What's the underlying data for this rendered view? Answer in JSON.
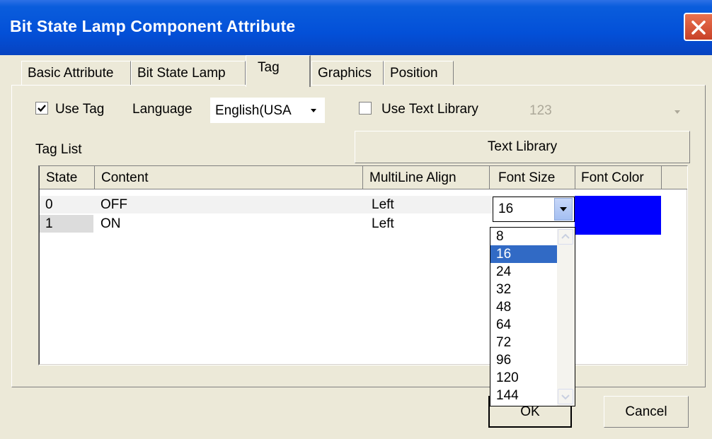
{
  "window": {
    "title": "Bit State Lamp Component Attribute",
    "close_icon": "close-icon"
  },
  "tabs": [
    {
      "label": "Basic Attribute",
      "active": false
    },
    {
      "label": "Bit State Lamp",
      "active": false
    },
    {
      "label": "Tag",
      "active": true
    },
    {
      "label": "Graphics",
      "active": false
    },
    {
      "label": "Position",
      "active": false
    }
  ],
  "tag_options": {
    "use_tag_label": "Use Tag",
    "use_tag_checked": true,
    "language_label": "Language",
    "language_value": "English(USA",
    "use_text_library_label": "Use Text Library",
    "use_text_library_checked": false,
    "text_library_select_value": "123",
    "text_library_button": "Text Library",
    "tag_list_label": "Tag List"
  },
  "table": {
    "columns": [
      "State",
      "Content",
      "MultiLine Align",
      "Font Size",
      "Font Color"
    ],
    "rows": [
      {
        "state": "0",
        "content": "OFF",
        "align": "Left",
        "font_size": "16",
        "font_color": "#0000ff"
      },
      {
        "state": "1",
        "content": "ON",
        "align": "Left",
        "font_size": "",
        "font_color": "#0000ff"
      }
    ]
  },
  "font_size_dropdown": {
    "value": "16",
    "options": [
      "8",
      "16",
      "24",
      "32",
      "48",
      "64",
      "72",
      "96",
      "120",
      "144"
    ],
    "selected": "16"
  },
  "buttons": {
    "ok": "OK",
    "cancel": "Cancel"
  },
  "colors": {
    "title_bar": "#0350d8",
    "selection": "#316ac5",
    "font_color_swatch": "#0000ff",
    "dialog_bg": "#ece9d8"
  }
}
